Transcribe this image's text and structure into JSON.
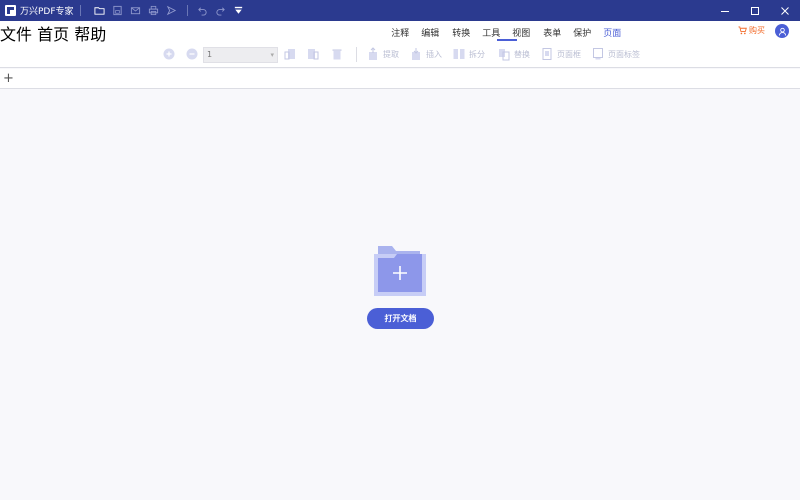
{
  "app": {
    "title": "万兴PDF专家"
  },
  "menu": {
    "left": [
      "文件",
      "首页",
      "帮助"
    ],
    "tabs": [
      "注释",
      "编辑",
      "转换",
      "工具",
      "视图",
      "表单",
      "保护",
      "页面"
    ],
    "active_tab": "页面",
    "buy_label": "购买"
  },
  "ribbon": {
    "page_value": "1",
    "labels": {
      "extract": "提取",
      "insert": "插入",
      "split": "拆分",
      "replace": "替换",
      "page_box": "页面框",
      "page_label": "页面标签"
    }
  },
  "empty_state": {
    "open_button": "打开文档"
  },
  "colors": {
    "titlebar": "#2b3a8f",
    "accent": "#4b5fd6",
    "buy": "#f26b2a"
  },
  "icons": {
    "quick_access": [
      "open-folder-icon",
      "save-icon",
      "mail-icon",
      "print-icon",
      "share-icon",
      "undo-icon",
      "redo-icon",
      "customize-icon"
    ],
    "window": [
      "minimize-icon",
      "maximize-icon",
      "close-icon"
    ]
  }
}
